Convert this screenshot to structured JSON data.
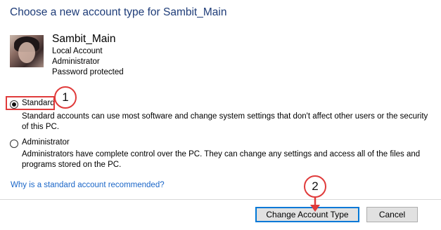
{
  "dialog": {
    "heading": "Choose a new account type for Sambit_Main"
  },
  "account": {
    "avatar_icon": "user-photo",
    "name": "Sambit_Main",
    "type": "Local Account",
    "role": "Administrator",
    "security": "Password protected"
  },
  "options": {
    "standard": {
      "label": "Standard",
      "selected": true,
      "description": "Standard accounts can use most software and change system settings that don't affect other users or the security of this PC."
    },
    "administrator": {
      "label": "Administrator",
      "selected": false,
      "description": "Administrators have complete control over the PC. They can change any settings and access all of the files and programs stored on the PC."
    }
  },
  "help_link": "Why is a standard account recommended?",
  "buttons": {
    "change": "Change Account Type",
    "cancel": "Cancel"
  },
  "annotations": {
    "step1": "1",
    "step2": "2",
    "color": "#e03b3b"
  },
  "colors": {
    "heading": "#1e3c78",
    "link": "#1a66c8",
    "focus_border": "#0078d7"
  }
}
